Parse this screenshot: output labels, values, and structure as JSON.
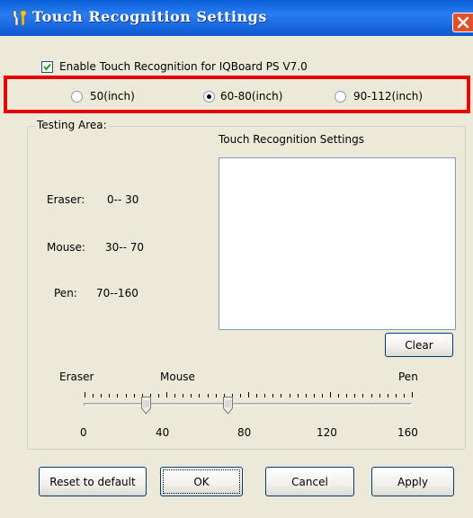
{
  "window": {
    "title": "Touch Recognition Settings"
  },
  "enable_checkbox": {
    "label": "Enable Touch Recognition for IQBoard PS V7.0",
    "checked": true
  },
  "screen_size": {
    "options": [
      {
        "label": "50(inch)",
        "selected": false
      },
      {
        "label": "60-80(inch)",
        "selected": true
      },
      {
        "label": "90-112(inch)",
        "selected": false
      }
    ]
  },
  "testing_area": {
    "title": "Testing Area:",
    "ranges": [
      {
        "name": "Eraser:",
        "range": "0-- 30"
      },
      {
        "name": "Mouse:",
        "range": "30-- 70"
      },
      {
        "name": "Pen:",
        "range": "70--160"
      }
    ],
    "settings_title": "Touch Recognition Settings",
    "clear_label": "Clear"
  },
  "slider": {
    "labels": {
      "eraser": "Eraser",
      "mouse": "Mouse",
      "pen": "Pen"
    },
    "scale": [
      "0",
      "40",
      "80",
      "120",
      "160"
    ],
    "min": 0,
    "max": 160,
    "eraser_mouse_boundary": 30,
    "mouse_pen_boundary": 70
  },
  "footer": {
    "reset_label": "Reset to default",
    "ok_label": "OK",
    "cancel_label": "Cancel",
    "apply_label": "Apply"
  }
}
